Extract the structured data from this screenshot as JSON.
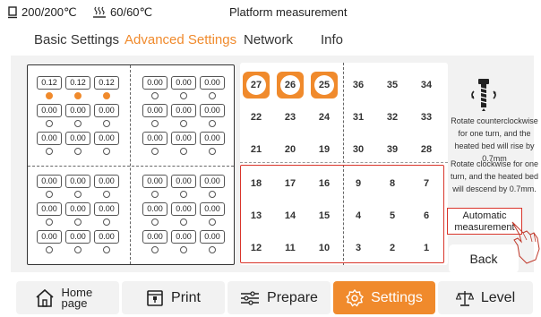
{
  "status": {
    "nozzle_temp": "200/200℃",
    "bed_temp": "60/60℃",
    "title": "Platform measurement",
    "nozzle_icon": "nozzle-icon",
    "bed_icon": "heated-bed-icon"
  },
  "tabs": [
    {
      "label": "Basic Settings",
      "active": false
    },
    {
      "label": "Advanced Settings",
      "active": true
    },
    {
      "label": "Network",
      "active": false
    },
    {
      "label": "Info",
      "active": false
    }
  ],
  "mesh": {
    "quadrants": [
      [
        [
          "0.12",
          "0.12",
          "0.12"
        ],
        [
          "0.00",
          "0.00",
          "0.00"
        ],
        [
          "0.00",
          "0.00",
          "0.00"
        ]
      ],
      [
        [
          "0.00",
          "0.00",
          "0.00"
        ],
        [
          "0.00",
          "0.00",
          "0.00"
        ],
        [
          "0.00",
          "0.00",
          "0.00"
        ]
      ],
      [
        [
          "0.00",
          "0.00",
          "0.00"
        ],
        [
          "0.00",
          "0.00",
          "0.00"
        ],
        [
          "0.00",
          "0.00",
          "0.00"
        ]
      ],
      [
        [
          "0.00",
          "0.00",
          "0.00"
        ],
        [
          "0.00",
          "0.00",
          "0.00"
        ],
        [
          "0.00",
          "0.00",
          "0.00"
        ]
      ]
    ],
    "active_dots": [
      [
        [
          true,
          true,
          true
        ],
        [
          false,
          false,
          false
        ],
        [
          false,
          false,
          false
        ]
      ],
      [
        [
          false,
          false,
          false
        ],
        [
          false,
          false,
          false
        ],
        [
          false,
          false,
          false
        ]
      ],
      [
        [
          false,
          false,
          false
        ],
        [
          false,
          false,
          false
        ],
        [
          false,
          false,
          false
        ]
      ],
      [
        [
          false,
          false,
          false
        ],
        [
          false,
          false,
          false
        ],
        [
          false,
          false,
          false
        ]
      ]
    ]
  },
  "points": {
    "rows": [
      [
        "27",
        "26",
        "25",
        "36",
        "35",
        "34"
      ],
      [
        "22",
        "23",
        "24",
        "31",
        "32",
        "33"
      ],
      [
        "21",
        "20",
        "19",
        "30",
        "39",
        "28"
      ],
      [
        "18",
        "17",
        "16",
        "9",
        "8",
        "7"
      ],
      [
        "13",
        "14",
        "15",
        "4",
        "5",
        "6"
      ],
      [
        "12",
        "11",
        "10",
        "3",
        "2",
        "1"
      ]
    ],
    "active": [
      "27",
      "26",
      "25"
    ]
  },
  "info": {
    "screw_icon": "screw-rotate-icon",
    "hint_ccw": "Rotate counterclockwise for one turn, and the heated bed will rise by 0.7mm",
    "hint_cw": "Rotate clockwise for one turn, and the heated bed will descend by 0.7mm.",
    "auto_label": "Automatic measurement",
    "back_label": "Back",
    "hand_icon": "pointing-hand-icon"
  },
  "nav": [
    {
      "label": "Home page",
      "icon": "home-icon",
      "active": false
    },
    {
      "label": "Print",
      "icon": "print-icon",
      "active": false
    },
    {
      "label": "Prepare",
      "icon": "sliders-icon",
      "active": false
    },
    {
      "label": "Settings",
      "icon": "gear-icon",
      "active": true
    },
    {
      "label": "Level",
      "icon": "level-icon",
      "active": false
    }
  ],
  "colors": {
    "accent": "#f08a2c",
    "highlight": "#d9352b",
    "panel": "#f2f2f2"
  }
}
